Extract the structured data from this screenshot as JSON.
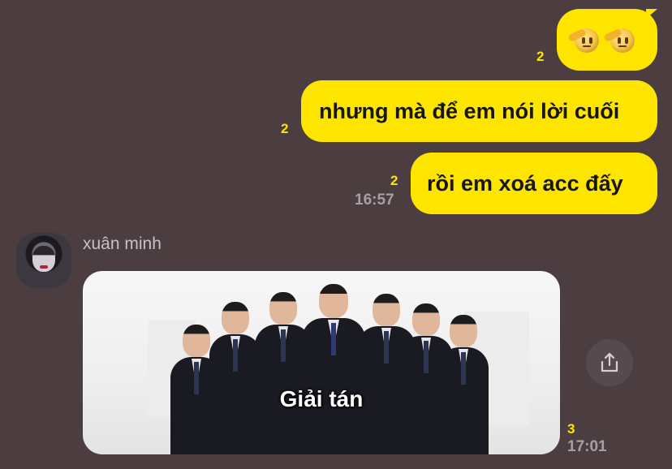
{
  "messages_sent": [
    {
      "id": "emoji",
      "text": "🫡🫡",
      "icon": "saluting-face-emoji",
      "unread": "2"
    },
    {
      "id": "m1",
      "text": "nhưng mà để em nói lời cuối",
      "unread": "2"
    },
    {
      "id": "m2",
      "text": "rồi em xoá acc đấy",
      "unread": "2",
      "time": "16:57"
    }
  ],
  "received": {
    "sender": "xuân minh",
    "image_caption": "Giải tán",
    "image_desc_icon": "group-photo",
    "unread": "3",
    "time": "17:01"
  },
  "icons": {
    "share": "share-icon",
    "avatar": "avatar"
  },
  "colors": {
    "background": "#4c3d41",
    "bubble": "#fee500",
    "unread": "#fee500",
    "time": "#a99fa1"
  }
}
